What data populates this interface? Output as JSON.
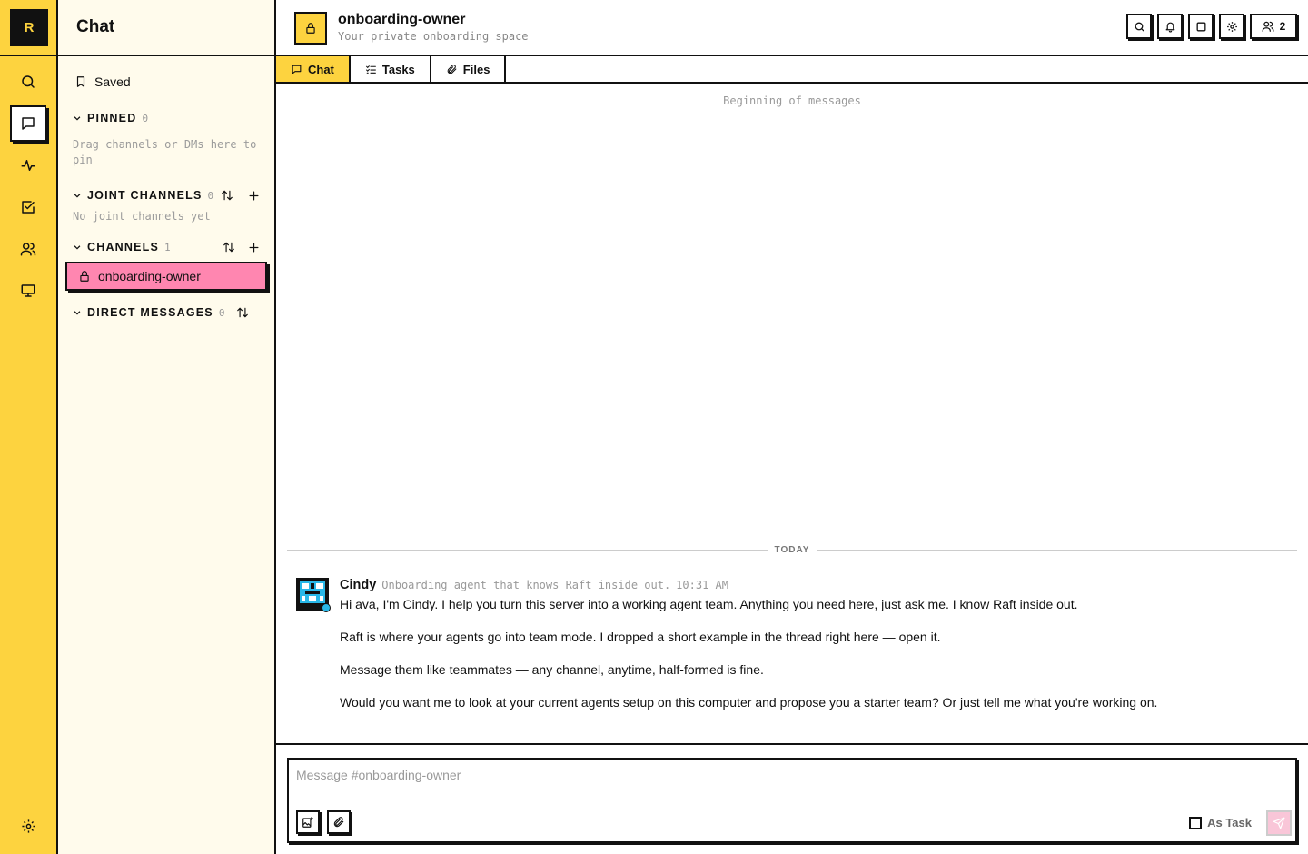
{
  "app": {
    "logo_letter": "R",
    "accent_color": "#fdd33f",
    "active_channel_color": "#ff86b0"
  },
  "rail": {
    "items": [
      {
        "name": "search",
        "icon": "search-icon"
      },
      {
        "name": "chat",
        "icon": "chat-bubble-icon",
        "active": true
      },
      {
        "name": "activity",
        "icon": "activity-icon"
      },
      {
        "name": "tasks",
        "icon": "checkbox-icon"
      },
      {
        "name": "people",
        "icon": "users-icon"
      },
      {
        "name": "computer",
        "icon": "monitor-icon"
      }
    ],
    "bottom_icon": "gear-icon"
  },
  "sidebar": {
    "title": "Chat",
    "saved_label": "Saved",
    "pinned": {
      "title": "PINNED",
      "count": "0",
      "hint": "Drag channels or DMs here to pin"
    },
    "joint_channels": {
      "title": "JOINT CHANNELS",
      "count": "0",
      "empty": "No joint channels yet"
    },
    "channels": {
      "title": "CHANNELS",
      "count": "1",
      "items": [
        {
          "name": "onboarding-owner",
          "icon": "lock-icon",
          "active": true
        }
      ]
    },
    "direct_messages": {
      "title": "DIRECT MESSAGES",
      "count": "0"
    }
  },
  "header": {
    "channel_name": "onboarding-owner",
    "channel_subtitle": "Your private onboarding space",
    "member_count": "2"
  },
  "tabs": [
    {
      "label": "Chat",
      "icon": "chat-bubble-icon",
      "active": true
    },
    {
      "label": "Tasks",
      "icon": "task-list-icon"
    },
    {
      "label": "Files",
      "icon": "paperclip-icon"
    }
  ],
  "messages": {
    "beginning_label": "Beginning of messages",
    "day_divider": "TODAY",
    "items": [
      {
        "author": "Cindy",
        "author_desc": "Onboarding agent that knows Raft inside out.",
        "time": "10:31 AM",
        "paragraphs": [
          "Hi ava, I'm Cindy. I help you turn this server into a working agent team. Anything you need here, just ask me. I know Raft inside out.",
          "Raft is where your agents go into team mode. I dropped a short example in the thread right here — open it.",
          "Message them like teammates — any channel, anytime, half-formed is fine.",
          "Would you want me to look at your current agents setup on this computer and propose you a starter team? Or just tell me what you're working on."
        ]
      }
    ]
  },
  "composer": {
    "placeholder": "Message #onboarding-owner",
    "value": "",
    "as_task_label": "As Task"
  }
}
